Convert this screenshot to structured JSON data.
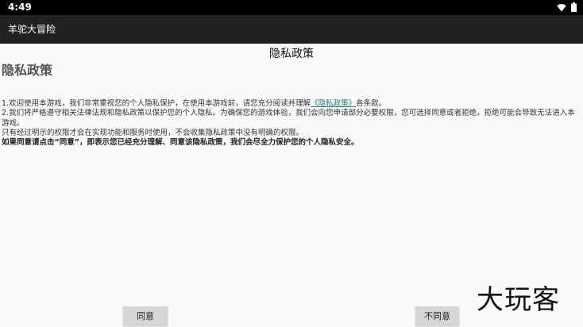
{
  "status_bar": {
    "time": "4:49",
    "icons": [
      "wifi-icon",
      "battery-icon"
    ]
  },
  "app_bar": {
    "title": "羊驼大冒险"
  },
  "dialog": {
    "title": "隐私政策",
    "heading": "隐私政策",
    "paragraph1_prefix": "1.欢迎使用本游戏，我们非常重视您的个人隐私保护，在使用本游戏前，请您充分阅读并理解",
    "paragraph1_link": "《隐私政策》",
    "paragraph1_suffix": "各条款。",
    "paragraph2": "2.我们将严格遵守相关法律法规和隐私政策以保护您的个人隐私。为确保您的游戏体验，我们会向您申请部分必要权限，您可选择同意或者拒绝，拒绝可能会导致无法进入本游戏。",
    "paragraph3": "只有经过明示的权限才会在实现功能和服务时使用，不会收集隐私政策中没有明确的权限。",
    "paragraph4": "如果同意请点击“同意”，即表示您已经充分理解、同意该隐私政策，我们会尽全力保护您的个人隐私安全。",
    "agree_label": "同意",
    "disagree_label": "不同意"
  },
  "watermark": {
    "text": "大玩客"
  },
  "colors": {
    "status_bar": "#000000",
    "app_bar": "#212121",
    "background": "#fafafa",
    "link": "#1a7f72",
    "button": "#d6d6d6"
  }
}
